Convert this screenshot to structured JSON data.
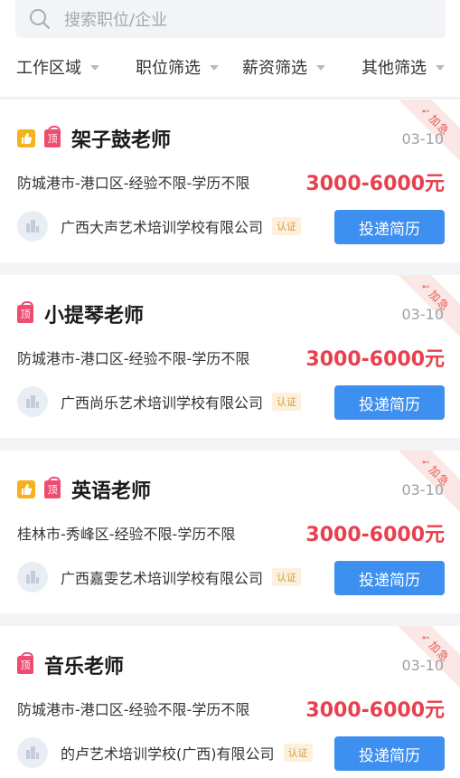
{
  "search": {
    "placeholder": "搜索职位/企业"
  },
  "filters": [
    {
      "label": "工作区域"
    },
    {
      "label": "职位筛选"
    },
    {
      "label": "薪资筛选"
    },
    {
      "label": "其他筛选"
    }
  ],
  "jobs": [
    {
      "title": "架子鼓老师",
      "date": "03-10",
      "meta": "防城港市-港口区-经验不限-学历不限",
      "salary": "3000-6000元",
      "company": "广西大声艺术培训学校有限公司",
      "verified": "认证",
      "apply": "投递简历",
      "tag_top": "顶",
      "ribbon": "加急",
      "has_thumb": true
    },
    {
      "title": "小提琴老师",
      "date": "03-10",
      "meta": "防城港市-港口区-经验不限-学历不限",
      "salary": "3000-6000元",
      "company": "广西尚乐艺术培训学校有限公司",
      "verified": "认证",
      "apply": "投递简历",
      "tag_top": "顶",
      "ribbon": "加急",
      "has_thumb": false
    },
    {
      "title": "英语老师",
      "date": "03-10",
      "meta": "桂林市-秀峰区-经验不限-学历不限",
      "salary": "3000-6000元",
      "company": "广西嘉雯艺术培训学校有限公司",
      "verified": "认证",
      "apply": "投递简历",
      "tag_top": "顶",
      "ribbon": "加急",
      "has_thumb": true
    },
    {
      "title": "音乐老师",
      "date": "03-10",
      "meta": "防城港市-港口区-经验不限-学历不限",
      "salary": "3000-6000元",
      "company": "的卢艺术培训学校(广西)有限公司",
      "verified": "认证",
      "apply": "投递简历",
      "tag_top": "顶",
      "ribbon": "加急",
      "has_thumb": false
    }
  ],
  "colors": {
    "accent": "#3d8ff0",
    "salary": "#e8404f",
    "top_badge": "#ef4c72",
    "thumb_badge": "#f5b21f"
  },
  "icons": {
    "search": "search-icon",
    "thumb": "thumbs-up-icon",
    "logo": "building-icon",
    "rocket": "rocket-icon"
  }
}
